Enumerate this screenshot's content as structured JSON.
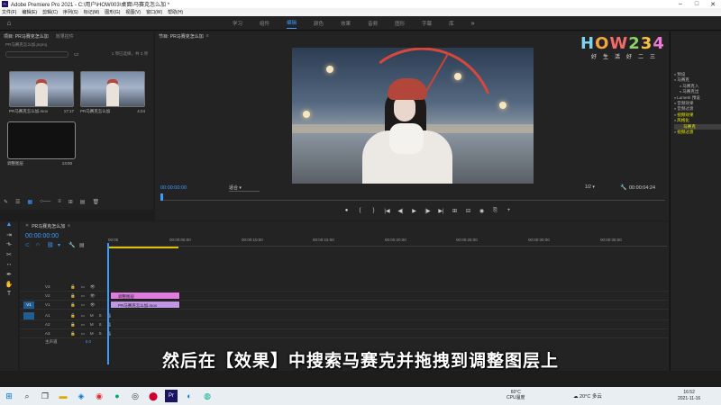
{
  "window": {
    "title": "Adobe Premiere Pro 2021 - C:\\用户\\HOW003\\桌面\\马赛克怎么加 *"
  },
  "menu": [
    "文件(F)",
    "编辑(E)",
    "剪辑(C)",
    "序列(S)",
    "标记(M)",
    "图形(G)",
    "视图(V)",
    "窗口(W)",
    "帮助(H)"
  ],
  "workspaces": {
    "tabs": [
      "学习",
      "组件",
      "编辑",
      "颜色",
      "效果",
      "音频",
      "图形",
      "字幕",
      "库"
    ],
    "active_index": 2
  },
  "project": {
    "tab_label": "项目: PR马赛克怎么加",
    "tab_inactive": "效果控件",
    "file_name": "PR马赛克怎么加.prproj",
    "item_count": "1 项已选择，共 3 项",
    "items": [
      {
        "name": "PR马赛克怎么加.mov",
        "duration": "17:17"
      },
      {
        "name": "PR马赛克怎么加",
        "duration": "4:24"
      },
      {
        "name": "调整图层",
        "duration": "13:00"
      }
    ]
  },
  "program": {
    "tab_label": "节目: PR马赛克怎么加",
    "timecode": "00:00:00:00",
    "zoom": "适合",
    "resolution": "1/2",
    "duration": "00:00:04:24",
    "transport": [
      "●",
      "{",
      "}",
      "|◀",
      "◀|",
      "▶",
      "|▶",
      "▶|",
      "⊞",
      "⊟",
      "◉",
      "⎘",
      "+"
    ]
  },
  "logo": {
    "text": "HOW234",
    "tagline": "好生活好二三"
  },
  "effects_panel": {
    "items": [
      {
        "label": "预设",
        "folder": true
      },
      {
        "label": "马赛克",
        "folder": true
      },
      {
        "label": "马赛克入",
        "folder": true
      },
      {
        "label": "马赛克出",
        "folder": true
      },
      {
        "label": "Lumetri 预设",
        "folder": true
      },
      {
        "label": "音频效果",
        "folder": true
      },
      {
        "label": "音频过渡",
        "folder": true
      },
      {
        "label": "视频效果",
        "folder": true,
        "highlight": true
      },
      {
        "label": "风格化",
        "folder": true,
        "highlight": true
      },
      {
        "label": "马赛克",
        "folder": false,
        "selected": true
      },
      {
        "label": "视频过渡",
        "folder": true,
        "highlight": true
      }
    ]
  },
  "timeline": {
    "tab_label": "PR马赛克怎么加",
    "timecode": "00:00:00:00",
    "ruler_ticks": [
      "00:00",
      "00:00:05:00",
      "00:00:10:00",
      "00:00:15:00",
      "00:00:20:00",
      "00:00:25:00",
      "00:00:30:00",
      "00:00:35:00"
    ],
    "video_tracks": [
      "V3",
      "V2",
      "V1"
    ],
    "audio_tracks": [
      "A1",
      "A2",
      "A3"
    ],
    "target_label": "V1",
    "clips": [
      {
        "label": "调整图层",
        "track": "V2",
        "kind": "adjustment"
      },
      {
        "label": "PR马赛克怎么加.mov",
        "track": "V1",
        "kind": "video"
      }
    ],
    "master_label": "主声道",
    "master_value": "0.0"
  },
  "subtitle": "然后在【效果】中搜索马赛克并拖拽到调整图层上",
  "taskbar": {
    "weather_temp": "60°C",
    "weather_text": "CPU温度",
    "temp2": "20°C 多云",
    "time": "16:52",
    "date": "2021-11-16"
  },
  "colors": {
    "accent": "#3b9cff",
    "adjustment_clip": "#e07be0",
    "video_clip": "#c196e6",
    "highlight": "#e6e600"
  }
}
